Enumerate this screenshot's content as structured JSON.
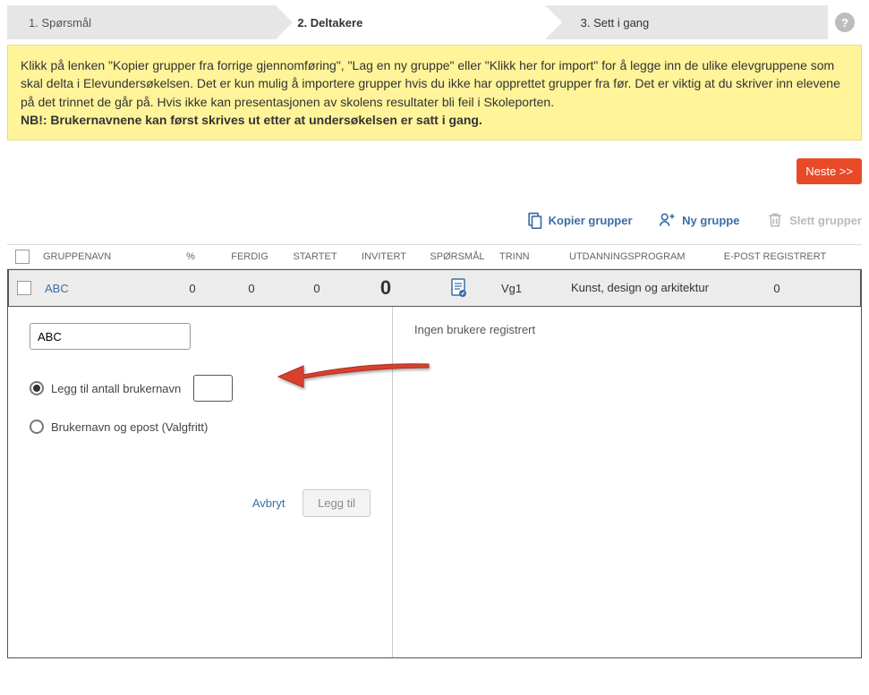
{
  "wizard": {
    "step1": "1. Spørsmål",
    "step2": "2. Deltakere",
    "step3": "3. Sett i gang",
    "help": "?"
  },
  "info": {
    "line1": "Klikk på lenken \"Kopier grupper fra forrige gjennomføring\", \"Lag en ny gruppe\" eller \"Klikk her for import\" for å legge inn de ulike elevgruppene som skal delta i Elevundersøkelsen. Det er kun mulig å importere grupper hvis du ikke har opprettet grupper fra før. Det er viktig at du skriver inn elevene på det trinnet de går på. Hvis ikke kan presentasjonen av skolens resultater bli feil i Skoleporten.",
    "line2": "NB!: Brukernavnene kan først skrives ut etter at undersøkelsen er satt i gang."
  },
  "buttons": {
    "next": "Neste >>",
    "copy": "Kopier grupper",
    "new": "Ny gruppe",
    "del": "Slett grupper"
  },
  "table": {
    "headers": {
      "name": "GRUPPENAVN",
      "pct": "%",
      "ferdig": "FERDIG",
      "startet": "STARTET",
      "invitert": "INVITERT",
      "spors": "SPØRSMÅL",
      "trinn": "TRINN",
      "utd": "UTDANNINGSPROGRAM",
      "epost": "E-POST REGISTRERT"
    },
    "row": {
      "name": "ABC",
      "pct": "0",
      "ferdig": "0",
      "startet": "0",
      "invitert": "0",
      "trinn": "Vg1",
      "utd": "Kunst, design og arkitektur",
      "epost": "0"
    }
  },
  "expand": {
    "nameValue": "ABC",
    "radio1": "Legg til antall brukernavn",
    "radio2": "Brukernavn og epost (Valgfritt)",
    "cancel": "Avbryt",
    "add": "Legg til",
    "rightMsg": "Ingen brukere registrert"
  }
}
